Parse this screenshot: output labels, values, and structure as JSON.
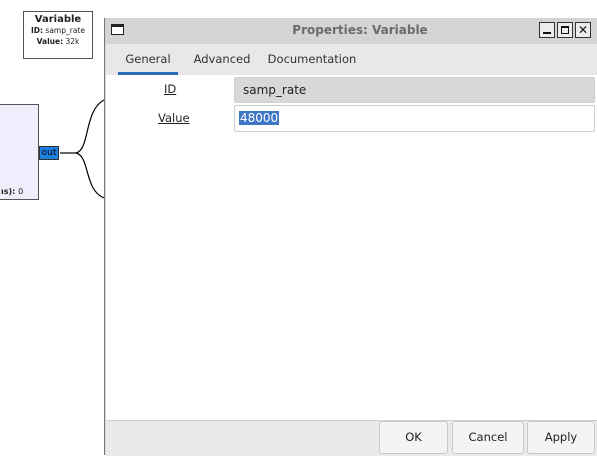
{
  "canvas": {
    "variable_block": {
      "title": "Variable",
      "id_key": "ID:",
      "id_value": "samp_rate",
      "value_key": "Value:",
      "value_value": "32k"
    },
    "source_block": {
      "param_key": "ıs):",
      "param_value": "0",
      "port_label": "out"
    }
  },
  "dialog": {
    "title": "Properties: Variable",
    "tabs": [
      {
        "label": "General",
        "active": true
      },
      {
        "label": "Advanced",
        "active": false
      },
      {
        "label": "Documentation",
        "active": false
      }
    ],
    "fields": {
      "id_label": "ID",
      "id_value": "samp_rate",
      "value_label": "Value",
      "value_value": "48000"
    },
    "buttons": {
      "ok": "OK",
      "cancel": "Cancel",
      "apply": "Apply"
    }
  },
  "colors": {
    "accent": "#2c6cb8",
    "selection": "#3e77c4",
    "port": "#1f7fe0"
  }
}
